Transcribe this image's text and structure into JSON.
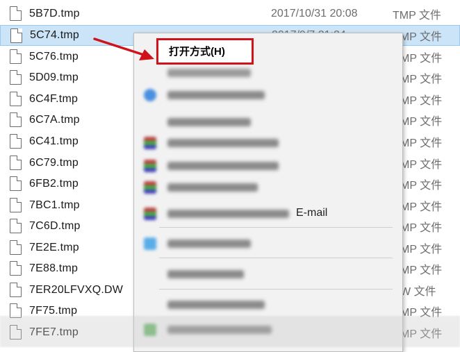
{
  "files": [
    {
      "name": "5B7D.tmp",
      "date": "2017/10/31 20:08",
      "type": "TMP 文件"
    },
    {
      "name": "5C74.tmp",
      "date": "2017/9/7 21:24",
      "type": "TMP 文件"
    },
    {
      "name": "5C76.tmp",
      "date": "",
      "type": "MP 文件"
    },
    {
      "name": "5D09.tmp",
      "date": "",
      "type": "MP 文件"
    },
    {
      "name": "6C4F.tmp",
      "date": "",
      "type": "MP 文件"
    },
    {
      "name": "6C7A.tmp",
      "date": "",
      "type": "MP 文件"
    },
    {
      "name": "6C41.tmp",
      "date": "",
      "type": "MP 文件"
    },
    {
      "name": "6C79.tmp",
      "date": "",
      "type": "MP 文件"
    },
    {
      "name": "6FB2.tmp",
      "date": "",
      "type": "MP 文件"
    },
    {
      "name": "7BC1.tmp",
      "date": "",
      "type": "MP 文件"
    },
    {
      "name": "7C6D.tmp",
      "date": "",
      "type": "MP 文件"
    },
    {
      "name": "7E2E.tmp",
      "date": "",
      "type": "MP 文件"
    },
    {
      "name": "7E88.tmp",
      "date": "",
      "type": "MP 文件"
    },
    {
      "name": "7ER20LFVXQ.DW",
      "date": "",
      "type": "W 文件"
    },
    {
      "name": "7F75.tmp",
      "date": "",
      "type": "MP 文件"
    },
    {
      "name": "7FE7.tmp",
      "date": "",
      "type": "MP 文件"
    }
  ],
  "menu": {
    "open_with": "打开方式(H)",
    "email_fragment": "E-mail"
  },
  "colors": {
    "highlight": "#d0121b",
    "selection": "#cce4f7",
    "arrow": "#d0121b"
  }
}
